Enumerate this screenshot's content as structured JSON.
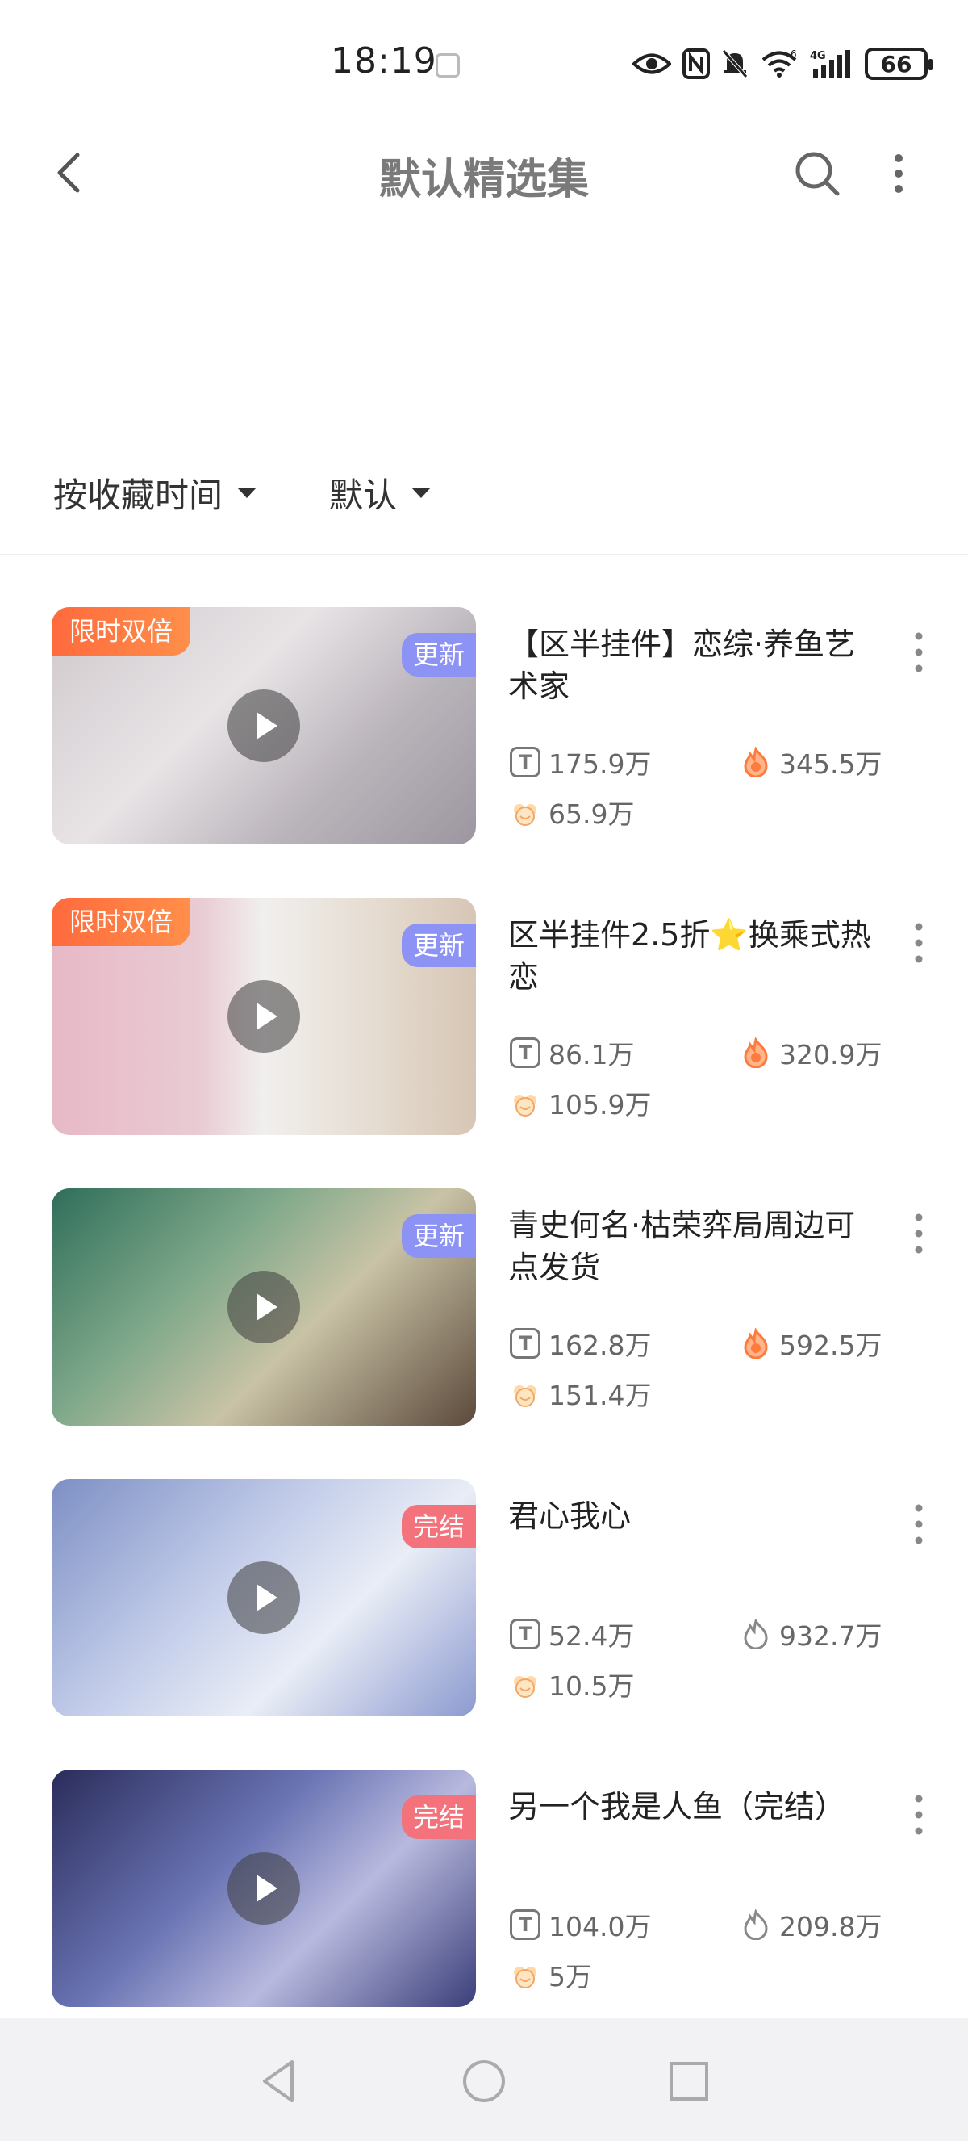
{
  "status_bar": {
    "time": "18:19",
    "network": "4G",
    "sim_badge": "6",
    "battery": "66",
    "icons": [
      "eye-icon",
      "nfc-icon",
      "bell-muted-icon",
      "wifi-icon",
      "signal-icon",
      "battery-icon"
    ]
  },
  "header": {
    "title": "默认精选集",
    "back_icon": "back-arrow-icon",
    "search_icon": "search-icon",
    "more_icon": "more-vertical-icon"
  },
  "sort_bar": {
    "sort_by": "按收藏时间",
    "filter": "默认"
  },
  "colors": {
    "promo_tag": "#ff6a3d",
    "update_tag": "#8d93f5",
    "done_tag": "#f3727b",
    "hot_icon": "#ff7a3d"
  },
  "items": [
    {
      "title": "【区半挂件】恋综·养鱼艺术家",
      "promo_tag": "限时双倍",
      "status_tag": "更新",
      "plays": "175.9万",
      "heat": "345.5万",
      "collects": "65.9万",
      "heat_icon": "flame-filled-icon"
    },
    {
      "title": "区半挂件2.5折⭐换乘式热恋",
      "promo_tag": "限时双倍",
      "status_tag": "更新",
      "plays": "86.1万",
      "heat": "320.9万",
      "collects": "105.9万",
      "heat_icon": "flame-filled-icon"
    },
    {
      "title": "青史何名·枯荣弈局周边可点发货",
      "promo_tag": "",
      "status_tag": "更新",
      "plays": "162.8万",
      "heat": "592.5万",
      "collects": "151.4万",
      "heat_icon": "flame-filled-icon"
    },
    {
      "title": "君心我心",
      "promo_tag": "",
      "status_tag": "完结",
      "plays": "52.4万",
      "heat": "932.7万",
      "collects": "10.5万",
      "heat_icon": "flame-outline-icon"
    },
    {
      "title": "另一个我是人鱼（完结）",
      "promo_tag": "",
      "status_tag": "完结",
      "plays": "104.0万",
      "heat": "209.8万",
      "collects": "5万",
      "heat_icon": "flame-outline-icon"
    }
  ],
  "nav_bar": {
    "back": "nav-back-icon",
    "home": "nav-home-icon",
    "recents": "nav-recents-icon"
  }
}
